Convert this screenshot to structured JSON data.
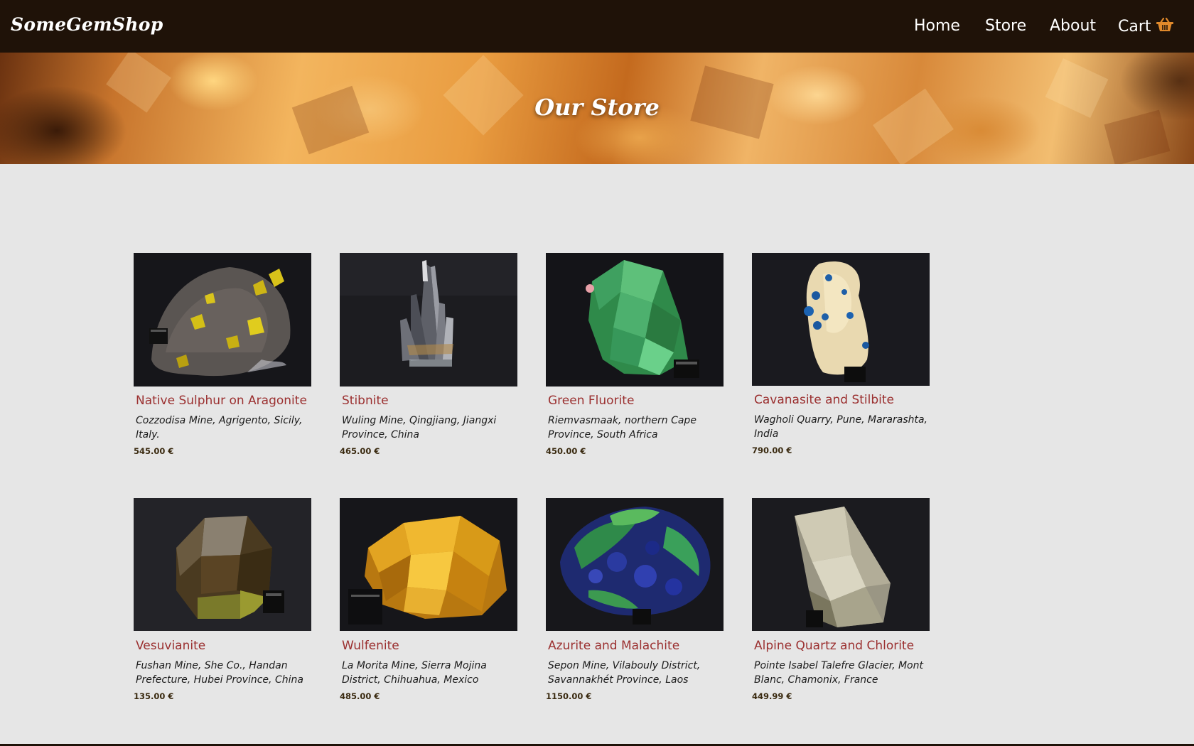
{
  "site": {
    "brand": "SomeGemShop"
  },
  "nav": {
    "home": "Home",
    "store": "Store",
    "about": "About",
    "cart": "Cart",
    "cart_icon": "shopping-basket-icon",
    "accent_color": "#e0892b"
  },
  "hero": {
    "title": "Our Store"
  },
  "colors": {
    "header_bg": "#1f1208",
    "page_bg": "#e6e6e6",
    "product_name": "#9b3030"
  },
  "products": [
    {
      "name": "Native Sulphur on Aragonite",
      "location": "Cozzodisa Mine, Agrigento, Sicily, Italy.",
      "price": "545.00 €",
      "image": "native-sulphur-photo"
    },
    {
      "name": "Stibnite",
      "location": "Wuling Mine, Qingjiang, Jiangxi Province, China",
      "price": "465.00 €",
      "image": "stibnite-photo"
    },
    {
      "name": "Green Fluorite",
      "location": "Riemvasmaak, northern Cape Province, South Africa",
      "price": "450.00 €",
      "image": "green-fluorite-photo"
    },
    {
      "name": "Cavanasite and Stilbite",
      "location": "Wagholi Quarry, Pune, Mararashta, India",
      "price": "790.00 €",
      "image": "cavansite-stilbite-photo"
    },
    {
      "name": "Vesuvianite",
      "location": "Fushan Mine, She Co., Handan Prefecture, Hubei Province, China",
      "price": "135.00 €",
      "image": "vesuvianite-photo"
    },
    {
      "name": "Wulfenite",
      "location": "La Morita Mine, Sierra Mojina District, Chihuahua, Mexico",
      "price": "485.00 €",
      "image": "wulfenite-photo"
    },
    {
      "name": "Azurite and Malachite",
      "location": "Sepon Mine, Vilabouly District, Savannakhét Province, Laos",
      "price": "1150.00 €",
      "image": "azurite-malachite-photo"
    },
    {
      "name": "Alpine Quartz and Chlorite",
      "location": "Pointe Isabel Talefre Glacier, Mont Blanc, Chamonix, France",
      "price": "449.99 €",
      "image": "alpine-quartz-photo"
    }
  ]
}
